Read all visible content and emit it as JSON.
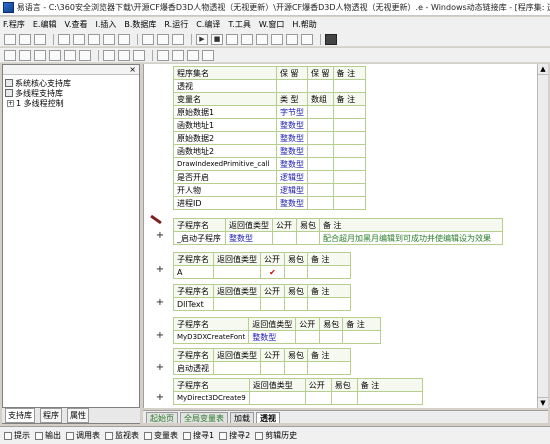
{
  "window": {
    "title": "易语言 - C:\\360安全浏览器下载\\开源CF爆香D3D人物透视（无视更新）\\开源CF爆香D3D人物透视（无视更新）.e - Windows动态链接库 - [程序集: 透视]"
  },
  "menu": [
    "F.程序",
    "E.编辑",
    "V.查看",
    "I.插入",
    "B.数据库",
    "R.运行",
    "C.编译",
    "T.工具",
    "W.窗口",
    "H.帮助"
  ],
  "left_panel": {
    "close_glyph": "×",
    "tree": [
      {
        "label": "系统核心支持库",
        "expander": ""
      },
      {
        "label": "多线程支持库",
        "expander": ""
      },
      {
        "label": "1 多线程控制",
        "expander": "+"
      }
    ],
    "tabs": [
      "支持库",
      "程序",
      "属性"
    ]
  },
  "assembly_table": {
    "header": [
      "程序集名",
      "保 留",
      "保 留",
      "备 注"
    ],
    "name": "透视",
    "var_header": [
      "变量名",
      "类 型",
      "数组",
      "备 注"
    ],
    "vars": [
      {
        "name": "原始数据1",
        "type": "字节型"
      },
      {
        "name": "函数地址1",
        "type": "整数型"
      },
      {
        "name": "原始数据2",
        "type": "整数型"
      },
      {
        "name": "函数地址2",
        "type": "整数型"
      },
      {
        "name": "DrawIndexedPrimitive_call",
        "type": "整数型"
      },
      {
        "name": "是否开启",
        "type": "逻辑型"
      },
      {
        "name": "开人物",
        "type": "逻辑型"
      },
      {
        "name": "进程ID",
        "type": "整数型"
      }
    ]
  },
  "subs": [
    {
      "header": [
        "子程序名",
        "返回值类型",
        "公开",
        "易包",
        "备 注"
      ],
      "name": "_启动子程序",
      "return_type": "整数型",
      "public": "",
      "note": "配合超月加黑月编辑到可成功并使编辑设为效果"
    },
    {
      "header": [
        "子程序名",
        "返回值类型",
        "公开",
        "易包",
        "备 注"
      ],
      "name": "A",
      "return_type": "",
      "public": "✔",
      "note": ""
    },
    {
      "header": [
        "子程序名",
        "返回值类型",
        "公开",
        "易包",
        "备 注"
      ],
      "name": "DllText",
      "return_type": "",
      "public": "",
      "note": ""
    },
    {
      "header": [
        "子程序名",
        "返回值类型",
        "公开",
        "易包",
        "备 注"
      ],
      "name": "MyD3DXCreateFont",
      "return_type": "整数型",
      "public": "",
      "note": ""
    },
    {
      "header": [
        "子程序名",
        "返回值类型",
        "公开",
        "易包",
        "备 注"
      ],
      "name": "启动透视",
      "return_type": "",
      "public": "",
      "note": ""
    },
    {
      "header": [
        "子程序名",
        "返回值类型",
        "公开",
        "易包",
        "备 注"
      ],
      "name": "MyDirect3DCreate9",
      "return_type": "",
      "public": "",
      "note": ""
    }
  ],
  "gutter_plus": "+",
  "editor_tabs": [
    "起始页",
    "全局变量表",
    "加载",
    "透视"
  ],
  "editor_tab_active": "透视",
  "status": [
    "提示",
    "输出",
    "调用表",
    "监视表",
    "变量表",
    "搜寻1",
    "搜寻2",
    "剪辑历史"
  ],
  "toolbar_glyphs": {
    "run": "▶",
    "stop": "■"
  }
}
